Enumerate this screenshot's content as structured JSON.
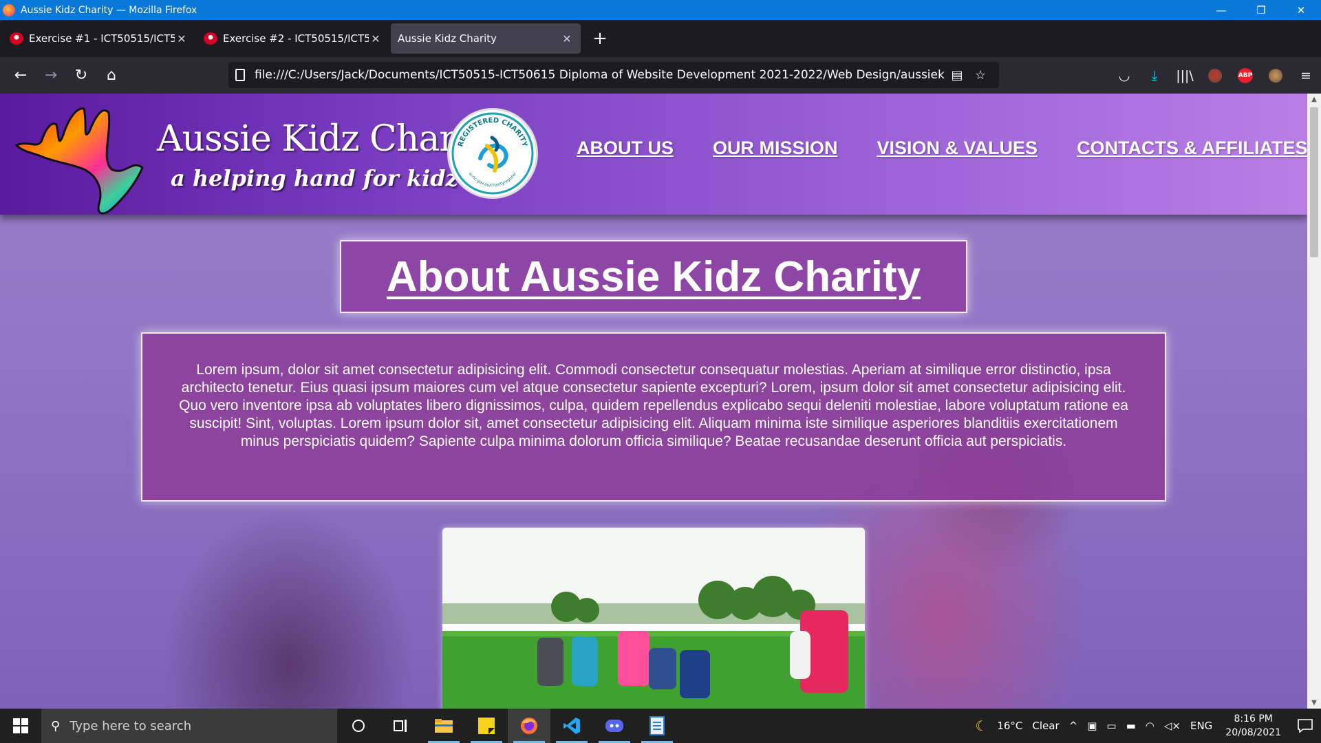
{
  "window": {
    "title": "Aussie Kidz Charity — Mozilla Firefox",
    "controls": {
      "minimize": "—",
      "restore": "❐",
      "close": "✕"
    }
  },
  "tabs": [
    {
      "label": "Exercise #1 - ICT50515/ICT50615",
      "close": "✕"
    },
    {
      "label": "Exercise #2 - ICT50515/ICT50615",
      "close": "✕"
    },
    {
      "label": "Aussie Kidz Charity",
      "close": "✕"
    }
  ],
  "new_tab": "+",
  "nav": {
    "back": "←",
    "forward": "→",
    "reload": "↻",
    "home": "⌂",
    "url": "file:///C:/Users/Jack/Documents/ICT50515-ICT50615 Diploma of Website Development 2021-2022/Web Design/aussiekids-website-p",
    "reader_icon": "▤",
    "bookmark_icon": "☆"
  },
  "toolbar": {
    "pocket_icon": "◡",
    "downloads_icon": "⤓",
    "library_icon": "|||\\",
    "abp_label": "ABP",
    "menu_icon": "≡"
  },
  "site": {
    "brand_title": "Aussie Kidz Charity",
    "brand_tagline": "a helping hand for kidz",
    "seal_top": "REGISTERED CHARITY",
    "seal_bottom": "acnc.gov.au/charityregister",
    "nav_links": [
      "ABOUT US",
      "OUR MISSION",
      "VISION & VALUES",
      "CONTACTS & AFFILIATES"
    ],
    "heading": "About Aussie Kidz Charity",
    "paragraph": "Lorem ipsum, dolor sit amet consectetur adipisicing elit. Commodi consectetur consequatur molestias. Aperiam at similique error distinctio, ipsa architecto tenetur. Eius quasi ipsum maiores cum vel atque consectetur sapiente excepturi? Lorem, ipsum dolor sit amet consectetur adipisicing elit. Quo vero inventore ipsa ab voluptates libero dignissimos, culpa, quidem repellendus explicabo sequi deleniti molestiae, labore voluptatum ratione ea suscipit! Sint, voluptas. Lorem ipsum dolor sit, amet consectetur adipisicing elit. Aliquam minima iste similique asperiores blanditiis exercitationem minus perspiciatis quidem? Sapiente culpa minima dolorum officia similique? Beatae recusandae deserunt officia aut perspiciatis."
  },
  "taskbar": {
    "search_placeholder": "Type here to search",
    "weather_temp": "16°C",
    "weather_text": "Clear",
    "language": "ENG",
    "time": "8:16 PM",
    "date": "20/08/2021"
  },
  "colors": {
    "titlebar": "#0a78d7",
    "header_start": "#5a1aa0",
    "header_end": "#b97ee6",
    "content_box": "#8c3c9a"
  }
}
